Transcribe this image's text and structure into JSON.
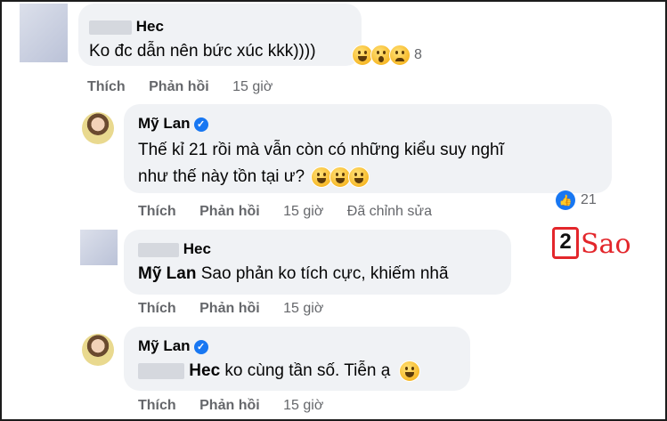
{
  "watermark": {
    "prefix": "2",
    "text": "Sao"
  },
  "comments": [
    {
      "author": "Hec",
      "text": "Ko đc dẫn nên bức xúc kkk))))",
      "reactions": {
        "icons": [
          "haha-icon",
          "wow-icon",
          "sad-icon"
        ],
        "count": "8"
      },
      "actions": {
        "like": "Thích",
        "reply": "Phản hồi",
        "time": "15 giờ"
      }
    },
    {
      "author": "Mỹ Lan",
      "verified": true,
      "text_line1": "Thế kỉ 21 rồi mà vẫn còn có những kiểu suy nghĩ",
      "text_line2": "như thế này tồn tại ư?",
      "reactions": {
        "icons": [
          "like-icon"
        ],
        "count": "21"
      },
      "actions": {
        "like": "Thích",
        "reply": "Phản hồi",
        "time": "15 giờ",
        "edited": "Đã chỉnh sửa"
      }
    },
    {
      "author": "Hec",
      "mention": "Mỹ Lan",
      "text": "Sao phản ko tích cực, khiếm nhã",
      "actions": {
        "like": "Thích",
        "reply": "Phản hồi",
        "time": "15 giờ"
      }
    },
    {
      "author": "Mỹ Lan",
      "verified": true,
      "mention": "Hec",
      "text": "ko cùng tần số. Tiễn ạ",
      "actions": {
        "like": "Thích",
        "reply": "Phản hồi",
        "time": "15 giờ"
      }
    }
  ]
}
